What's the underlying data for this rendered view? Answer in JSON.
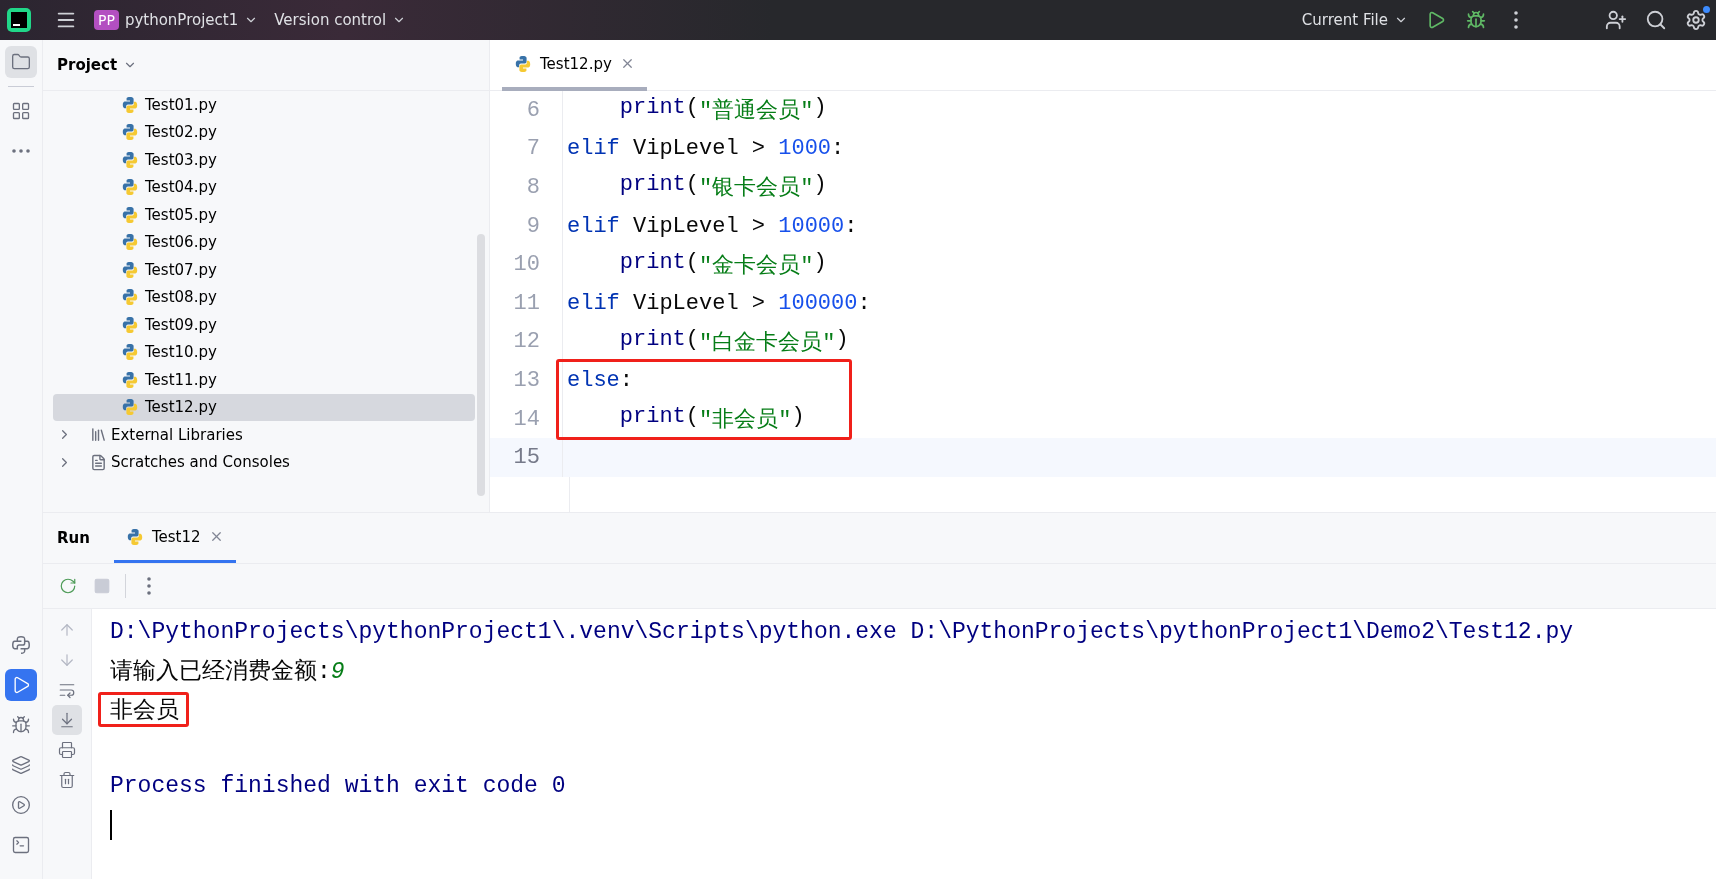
{
  "title_bar": {
    "project_badge": "PP",
    "project_name": "pythonProject1",
    "vcs_menu": "Version control",
    "run_config": "Current File",
    "settings_notification": true
  },
  "side_strip": {
    "top_items": [
      {
        "kind": "folder",
        "selected": true
      },
      {
        "kind": "structure",
        "selected": false
      },
      {
        "kind": "more",
        "selected": false
      }
    ],
    "bottom_items": [
      {
        "kind": "python",
        "selected": false
      },
      {
        "kind": "run",
        "selected": true
      },
      {
        "kind": "debug",
        "selected": false
      },
      {
        "kind": "layers",
        "selected": false
      },
      {
        "kind": "services",
        "selected": false
      },
      {
        "kind": "terminal",
        "selected": false
      }
    ]
  },
  "project_panel": {
    "title": "Project",
    "files": [
      {
        "name": "Test01.py",
        "selected": false
      },
      {
        "name": "Test02.py",
        "selected": false
      },
      {
        "name": "Test03.py",
        "selected": false
      },
      {
        "name": "Test04.py",
        "selected": false
      },
      {
        "name": "Test05.py",
        "selected": false
      },
      {
        "name": "Test06.py",
        "selected": false
      },
      {
        "name": "Test07.py",
        "selected": false
      },
      {
        "name": "Test08.py",
        "selected": false
      },
      {
        "name": "Test09.py",
        "selected": false
      },
      {
        "name": "Test10.py",
        "selected": false
      },
      {
        "name": "Test11.py",
        "selected": false
      },
      {
        "name": "Test12.py",
        "selected": true
      }
    ],
    "roots": [
      {
        "kind": "libraries",
        "name": "External Libraries",
        "expanded": false
      },
      {
        "kind": "scratches",
        "name": "Scratches and Consoles",
        "expanded": false
      }
    ]
  },
  "editor": {
    "tabs": [
      {
        "label": "Test12.py",
        "selected": true
      }
    ],
    "lines": [
      {
        "number": "6",
        "current": false,
        "highlighted": false,
        "tokens": [
          {
            "kind": "call",
            "text": "    print"
          },
          {
            "kind": "plain",
            "text": "("
          },
          {
            "kind": "string",
            "text": "\"普通会员\""
          },
          {
            "kind": "plain",
            "text": ")"
          }
        ]
      },
      {
        "number": "7",
        "current": false,
        "highlighted": false,
        "tokens": [
          {
            "kind": "keyword",
            "text": "elif"
          },
          {
            "kind": "plain",
            "text": " VipLevel > "
          },
          {
            "kind": "number",
            "text": "1000"
          },
          {
            "kind": "plain",
            "text": ":"
          }
        ]
      },
      {
        "number": "8",
        "current": false,
        "highlighted": false,
        "tokens": [
          {
            "kind": "call",
            "text": "    print"
          },
          {
            "kind": "plain",
            "text": "("
          },
          {
            "kind": "string",
            "text": "\"银卡会员\""
          },
          {
            "kind": "plain",
            "text": ")"
          }
        ]
      },
      {
        "number": "9",
        "current": false,
        "highlighted": false,
        "tokens": [
          {
            "kind": "keyword",
            "text": "elif"
          },
          {
            "kind": "plain",
            "text": " VipLevel > "
          },
          {
            "kind": "number",
            "text": "10000"
          },
          {
            "kind": "plain",
            "text": ":"
          }
        ]
      },
      {
        "number": "10",
        "current": false,
        "highlighted": false,
        "tokens": [
          {
            "kind": "call",
            "text": "    print"
          },
          {
            "kind": "plain",
            "text": "("
          },
          {
            "kind": "string",
            "text": "\"金卡会员\""
          },
          {
            "kind": "plain",
            "text": ")"
          }
        ]
      },
      {
        "number": "11",
        "current": false,
        "highlighted": false,
        "tokens": [
          {
            "kind": "keyword",
            "text": "elif"
          },
          {
            "kind": "plain",
            "text": " VipLevel > "
          },
          {
            "kind": "number",
            "text": "100000"
          },
          {
            "kind": "plain",
            "text": ":"
          }
        ]
      },
      {
        "number": "12",
        "current": false,
        "highlighted": false,
        "tokens": [
          {
            "kind": "call",
            "text": "    print"
          },
          {
            "kind": "plain",
            "text": "("
          },
          {
            "kind": "string",
            "text": "\"白金卡会员\""
          },
          {
            "kind": "plain",
            "text": ")"
          }
        ]
      },
      {
        "number": "13",
        "current": false,
        "highlighted": true,
        "tokens": [
          {
            "kind": "keyword",
            "text": "else"
          },
          {
            "kind": "plain",
            "text": ":"
          }
        ]
      },
      {
        "number": "14",
        "current": false,
        "highlighted": true,
        "tokens": [
          {
            "kind": "call",
            "text": "    print"
          },
          {
            "kind": "plain",
            "text": "("
          },
          {
            "kind": "string",
            "text": "\"非会员\""
          },
          {
            "kind": "plain",
            "text": ")"
          }
        ]
      },
      {
        "number": "15",
        "current": true,
        "highlighted": false
      }
    ]
  },
  "run_panel": {
    "title": "Run",
    "tabs": [
      {
        "label": "Test12",
        "selected": true
      }
    ],
    "toolbar": [
      {
        "kind": "rerun",
        "selected": false
      },
      {
        "kind": "stop",
        "selected": false
      },
      {
        "kind": "more",
        "selected": false
      }
    ],
    "side_tools": [
      {
        "kind": "up",
        "selected": false
      },
      {
        "kind": "down",
        "selected": false
      },
      {
        "kind": "wrap",
        "selected": false
      },
      {
        "kind": "scroll_end",
        "selected": true
      },
      {
        "kind": "print",
        "selected": false
      },
      {
        "kind": "clear",
        "selected": false
      }
    ],
    "console": [
      {
        "kind": "command",
        "text": "D:\\PythonProjects\\pythonProject1\\.venv\\Scripts\\python.exe D:\\PythonProjects\\pythonProject1\\Demo2\\Test12.py",
        "highlighted": false
      },
      {
        "kind": "prompt",
        "text": "请输入已经消费金额:",
        "input": "9",
        "highlighted": false
      },
      {
        "kind": "output",
        "text": "非会员",
        "highlighted": true
      },
      {
        "kind": "blank",
        "highlighted": false
      },
      {
        "kind": "command",
        "text": "Process finished with exit code 0",
        "highlighted": false
      },
      {
        "kind": "caret",
        "highlighted": false
      }
    ]
  }
}
